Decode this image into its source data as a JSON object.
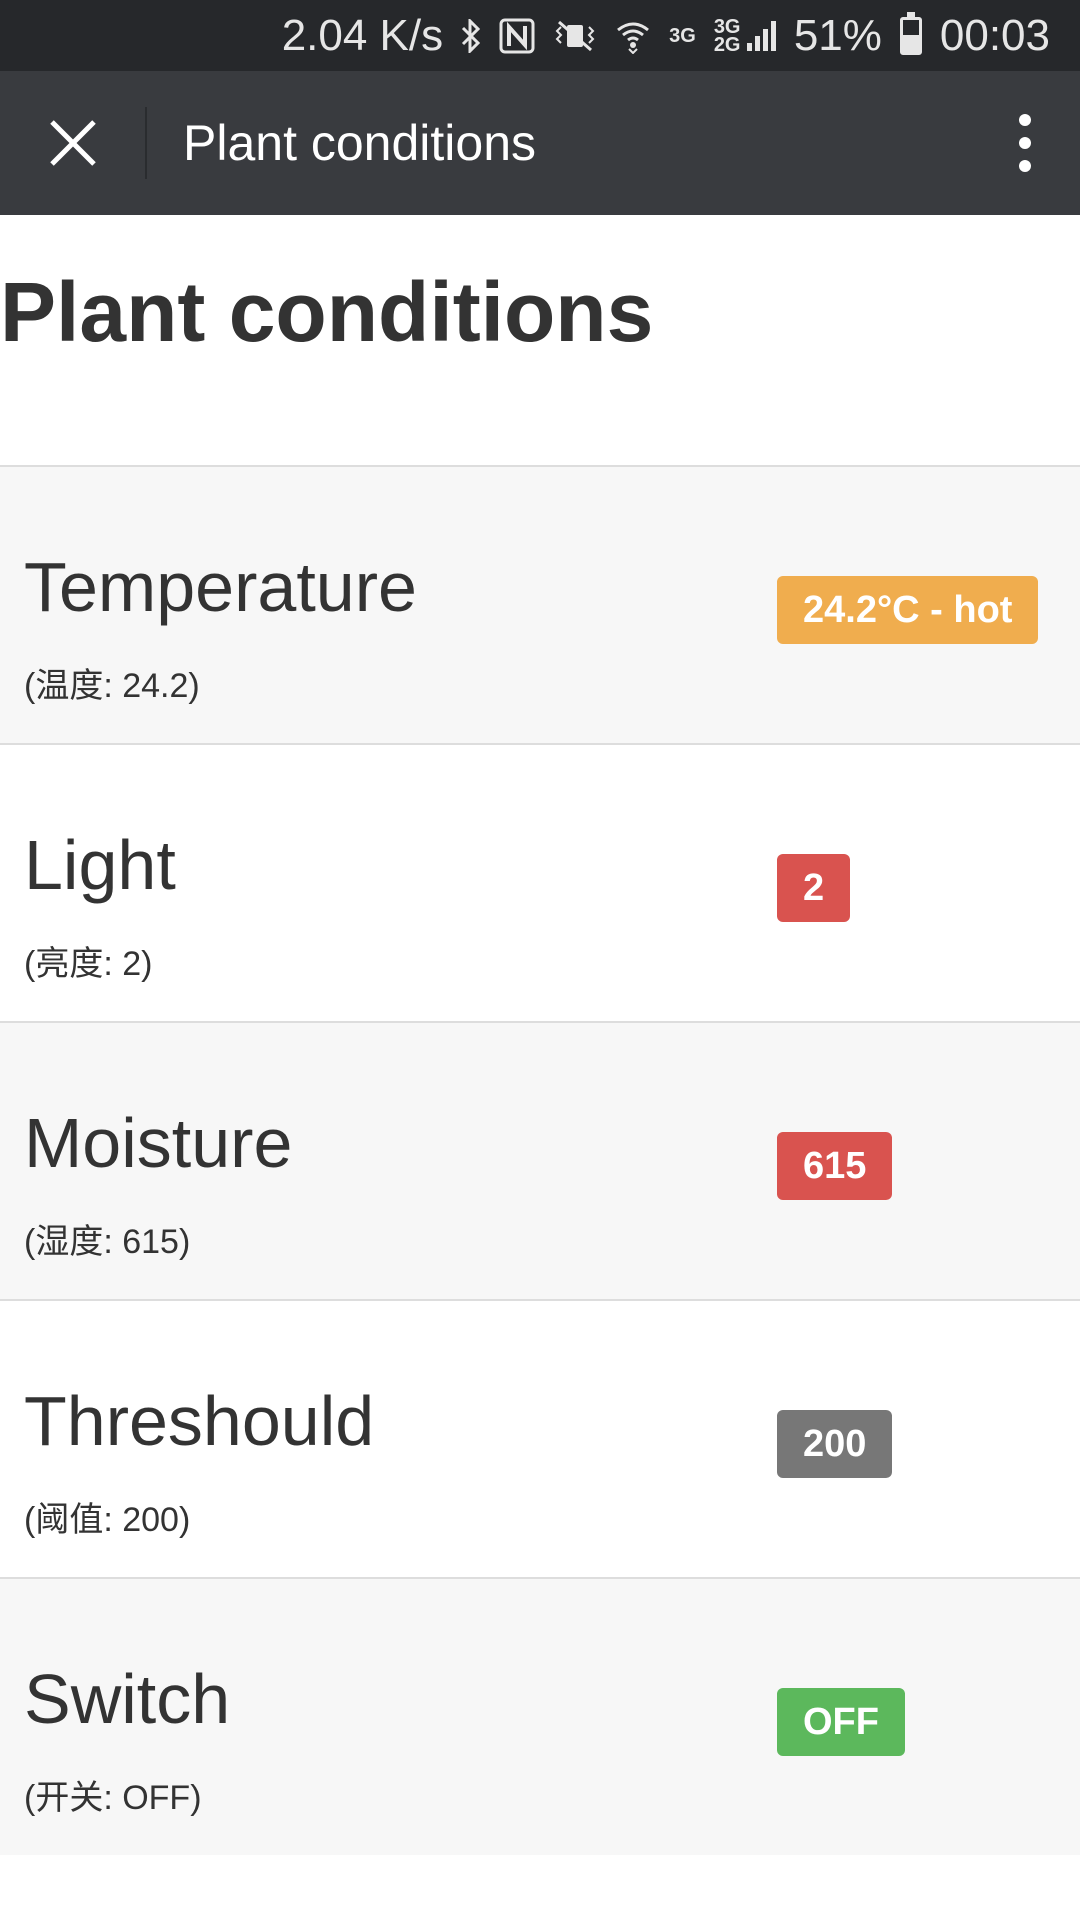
{
  "status_bar": {
    "speed": "2.04 K/s",
    "network_top": "3G",
    "network_mixed": "3G 2G",
    "battery": "51%",
    "battery_level": 0.51,
    "time": "00:03",
    "icons": [
      "bluetooth-icon",
      "nfc-icon",
      "mute-vibrate-icon",
      "wifi-icon",
      "signal-icon",
      "battery-icon"
    ]
  },
  "app_bar": {
    "title": "Plant conditions",
    "close_icon": "close-icon",
    "menu_icon": "more-vert-icon"
  },
  "page": {
    "heading": "Plant conditions"
  },
  "rows": [
    {
      "title": "Temperature",
      "subtitle": "(温度: 24.2)",
      "badge": "24.2°C - hot",
      "badge_color": "#f0ad4e"
    },
    {
      "title": "Light",
      "subtitle": "(亮度: 2)",
      "badge": "2",
      "badge_color": "#d9534f"
    },
    {
      "title": "Moisture",
      "subtitle": "(湿度: 615)",
      "badge": "615",
      "badge_color": "#d9534f"
    },
    {
      "title": "Threshould",
      "subtitle": "(阈值: 200)",
      "badge": "200",
      "badge_color": "#777777"
    },
    {
      "title": "Switch",
      "subtitle": "(开关: OFF)",
      "badge": "OFF",
      "badge_color": "#5cb85c"
    }
  ]
}
